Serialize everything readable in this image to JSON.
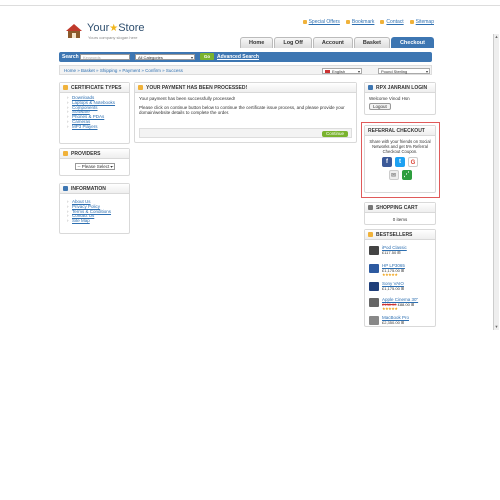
{
  "header": {
    "logo_name": "Your",
    "logo_name2": "Store",
    "logo_tagline": "Yours company slogan here",
    "top_links": [
      "Special Offers",
      "Bookmark",
      "Contact",
      "Sitemap"
    ],
    "tabs": [
      "Home",
      "Log Off",
      "Account",
      "Basket",
      "Checkout"
    ],
    "active_tab": "Checkout"
  },
  "search": {
    "label": "Search",
    "placeholder": "Keywords",
    "category": "All Categories",
    "go_label": "Go",
    "advanced_label": "Advanced Search"
  },
  "breadcrumb": [
    "Home",
    "Basket",
    "Shipping",
    "Payment",
    "Confirm",
    "Success"
  ],
  "language_select": "English",
  "currency_select": "Pound Sterling",
  "left": {
    "certificate_types": {
      "title": "CERTIFICATE TYPES",
      "items": [
        "Downloads",
        "Laptops & Notebooks",
        "Components",
        "Software",
        "Phones & PDAs",
        "Cameras",
        "MP3 Players"
      ]
    },
    "providers": {
      "title": "PROVIDERS",
      "select": "-- Please Select --"
    },
    "information": {
      "title": "INFORMATION",
      "items": [
        "About Us",
        "Privacy Policy",
        "Terms & Conditions",
        "Contact Us",
        "Site Map"
      ]
    }
  },
  "main": {
    "title": "YOUR PAYMENT HAS BEEN PROCESSED!",
    "line1": "Your payment has been successfully processed!",
    "line2": "Please click on continue button below to continue the certificate issue process, and please provide your domain/website details to complete the order.",
    "continue_label": "Continue"
  },
  "right": {
    "janrain": {
      "title": "RPX JANRAIN LOGIN",
      "welcome": "Welcome Vinod Hsn",
      "logout_label": "Logout"
    },
    "referral": {
      "title": "REFERRAL CHECKOUT",
      "text": "Share with your friends on Social Networks and get 5% Referral Checkout Coupon."
    },
    "cart": {
      "title": "SHOPPING CART",
      "status": "0 items"
    },
    "bestsellers": {
      "title": "BESTSELLERS",
      "products": [
        {
          "name": "iPod Classic",
          "price": "£117.50 ⊞"
        },
        {
          "name": "HP LP3065",
          "price": "£1,175.00 ⊞"
        },
        {
          "name": "Sony VAIO",
          "price": "£1,175.00 ⊞"
        },
        {
          "name": "Apple Cinema 30\"",
          "old_price": "£138.00",
          "price": "£88.00 ⊞"
        },
        {
          "name": "MacBook Pro",
          "price": "£2,350.00 ⊞"
        }
      ]
    }
  },
  "colors": {
    "accent": "#3d76b2",
    "go": "#7ab32e",
    "referral_outline": "#e05a5a",
    "link": "#2d6fb1"
  }
}
